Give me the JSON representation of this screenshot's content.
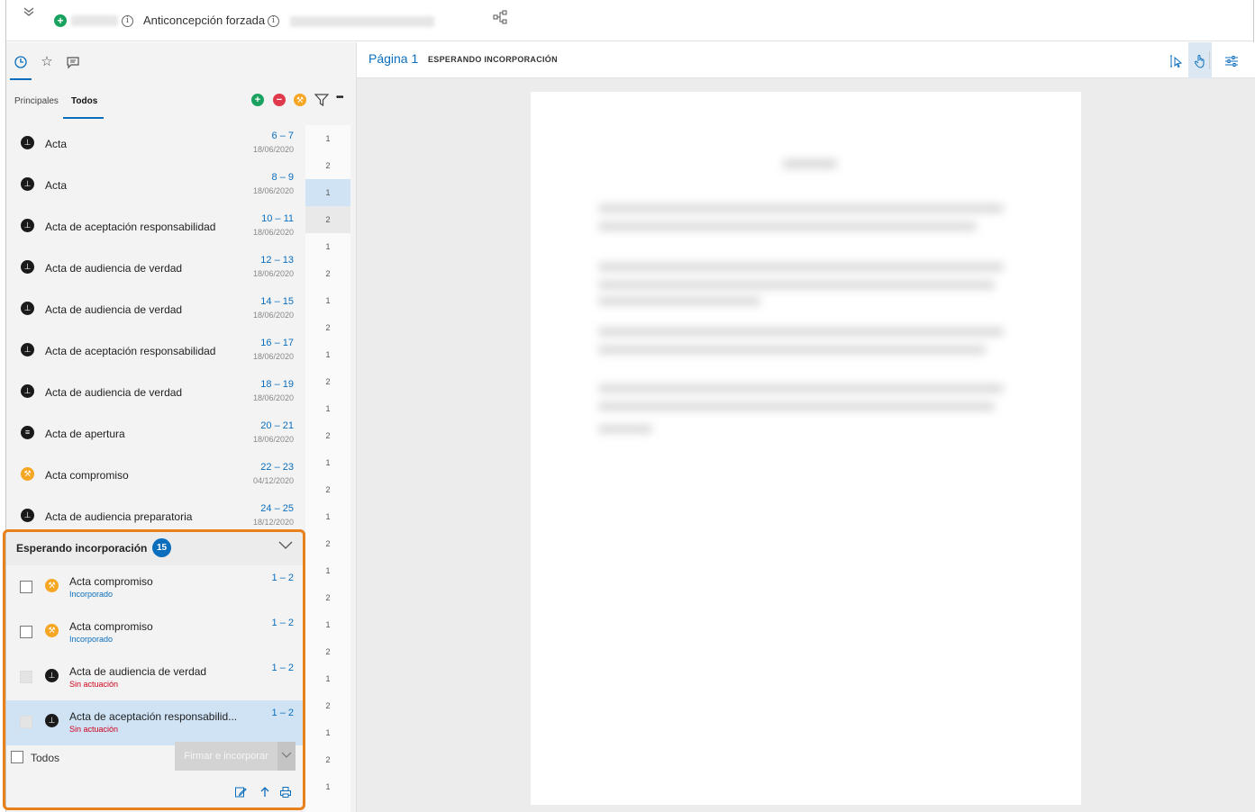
{
  "topbar": {
    "case_title": "Anticoncepción forzada",
    "collapse_icon": "double-chevron-down-icon",
    "info_icon": "info-icon",
    "tree_icon": "hierarchy-icon"
  },
  "leftpanel": {
    "tabs": [
      {
        "name": "history-icon",
        "glyph": "◷"
      },
      {
        "name": "star-icon",
        "glyph": "☆"
      },
      {
        "name": "comment-icon",
        "glyph": "▭"
      }
    ],
    "subtabs": {
      "principales": "Principales",
      "todos": "Todos"
    },
    "actions": {
      "add": "+",
      "remove": "−",
      "more": "•••",
      "filter_icon": "filter-icon",
      "seal_icon": "seal-icon"
    },
    "documents": [
      {
        "name": "Acta",
        "range": "6 – 7",
        "date": "18/06/2020",
        "icon": "stamp-icon",
        "color": "black"
      },
      {
        "name": "Acta",
        "range": "8 – 9",
        "date": "18/06/2020",
        "icon": "stamp-icon",
        "color": "black"
      },
      {
        "name": "Acta de aceptación responsabilidad",
        "range": "10 – 11",
        "date": "18/06/2020",
        "icon": "stamp-icon",
        "color": "black"
      },
      {
        "name": "Acta de audiencia de verdad",
        "range": "12 – 13",
        "date": "18/06/2020",
        "icon": "stamp-icon",
        "color": "black"
      },
      {
        "name": "Acta de audiencia de verdad",
        "range": "14 – 15",
        "date": "18/06/2020",
        "icon": "stamp-icon",
        "color": "black"
      },
      {
        "name": "Acta de aceptación responsabilidad",
        "range": "16 – 17",
        "date": "18/06/2020",
        "icon": "stamp-icon",
        "color": "black"
      },
      {
        "name": "Acta de audiencia de verdad",
        "range": "18 – 19",
        "date": "18/06/2020",
        "icon": "stamp-icon",
        "color": "black"
      },
      {
        "name": "Acta de apertura",
        "range": "20 – 21",
        "date": "18/06/2020",
        "icon": "document-icon",
        "color": "black"
      },
      {
        "name": "Acta compromiso",
        "range": "22 – 23",
        "date": "04/12/2020",
        "icon": "seal-icon",
        "color": "orange"
      },
      {
        "name": "Acta de audiencia preparatoria",
        "range": "24 – 25",
        "date": "18/12/2020",
        "icon": "stamp-icon",
        "color": "black"
      }
    ],
    "page_numbers": [
      "1",
      "2",
      "1",
      "2",
      "1",
      "2",
      "1",
      "2",
      "1",
      "2",
      "1",
      "2",
      "1",
      "2",
      "1",
      "2",
      "1",
      "2",
      "1",
      "2",
      "1",
      "2",
      "1",
      "2",
      "1"
    ]
  },
  "waiting": {
    "title": "Esperando incorporación",
    "count": "15",
    "items": [
      {
        "name": "Acta compromiso",
        "status": "Incorporado",
        "range": "1 – 2",
        "icon": "seal-icon",
        "color": "orange",
        "status_type": "ok",
        "selected": false,
        "enabled": true
      },
      {
        "name": "Acta compromiso",
        "status": "Incorporado",
        "range": "1 – 2",
        "icon": "seal-icon",
        "color": "orange",
        "status_type": "ok",
        "selected": false,
        "enabled": true
      },
      {
        "name": "Acta de audiencia de verdad",
        "status": "Sin actuación",
        "range": "1 – 2",
        "icon": "stamp-icon",
        "color": "black",
        "status_type": "bad",
        "selected": false,
        "enabled": false
      },
      {
        "name": "Acta de aceptación responsabilid...",
        "status": "Sin actuación",
        "range": "1 – 2",
        "icon": "stamp-icon",
        "color": "black",
        "status_type": "bad",
        "selected": true,
        "enabled": false
      }
    ],
    "select_all_label": "Todos",
    "sign_button": "Firmar e incorporar",
    "footer_icons": [
      "edit-icon",
      "upload-icon",
      "print-icon"
    ]
  },
  "viewer": {
    "page_label": "Página 1",
    "status_label": "ESPERANDO INCORPORACIÓN",
    "tools": [
      "text-select-icon",
      "hand-pan-icon",
      "settings-sliders-icon"
    ]
  }
}
